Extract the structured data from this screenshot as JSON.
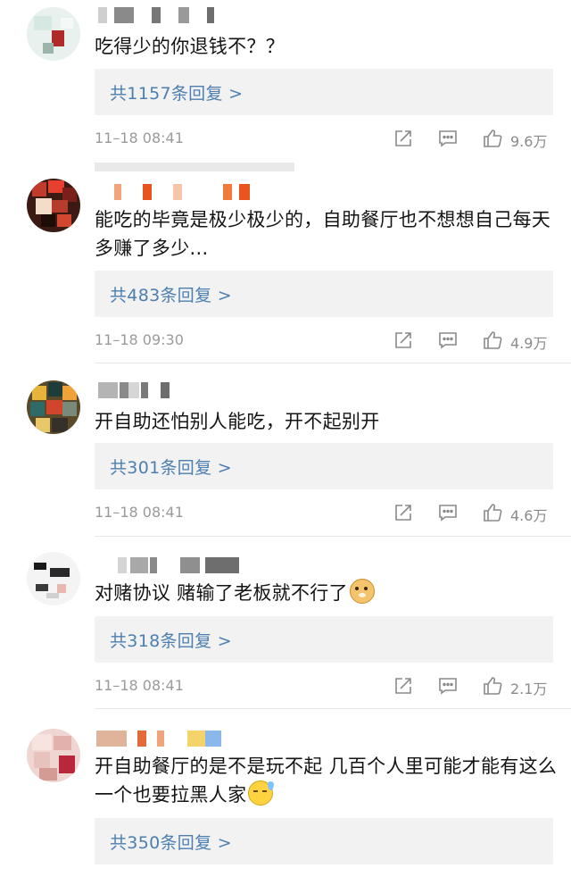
{
  "icons": {
    "share": "share-icon",
    "comment": "comment-icon",
    "like": "thumbs-up-icon"
  },
  "colors": {
    "reply_link": "#4c7fb0",
    "reply_bg": "#f2f2f2",
    "meta_text": "#9a9a9a"
  },
  "comments": [
    {
      "text": "吃得少的你退钱不？？",
      "reply_label": "共1157条回复 >",
      "time": "11–18 08:41",
      "likes": "9.6万"
    },
    {
      "text": "能吃的毕竟是极少极少的，自助餐厅也不想想自己每天多赚了多少...",
      "reply_label": "共483条回复 >",
      "time": "11–18 09:30",
      "likes": "4.9万"
    },
    {
      "text": "开自助还怕别人能吃，开不起别开",
      "reply_label": "共301条回复 >",
      "time": "11–18 08:41",
      "likes": "4.6万"
    },
    {
      "text": "对赌协议 赌输了老板就不行了",
      "emoji": "doge-emoji",
      "reply_label": "共318条回复 >",
      "time": "11–18 08:41",
      "likes": "2.1万"
    },
    {
      "text": "开自助餐厅的是不是玩不起 几百个人里可能才能有这么一个也要拉黑人家",
      "emoji": "sweat-emoji",
      "reply_label": "共350条回复 >"
    }
  ]
}
